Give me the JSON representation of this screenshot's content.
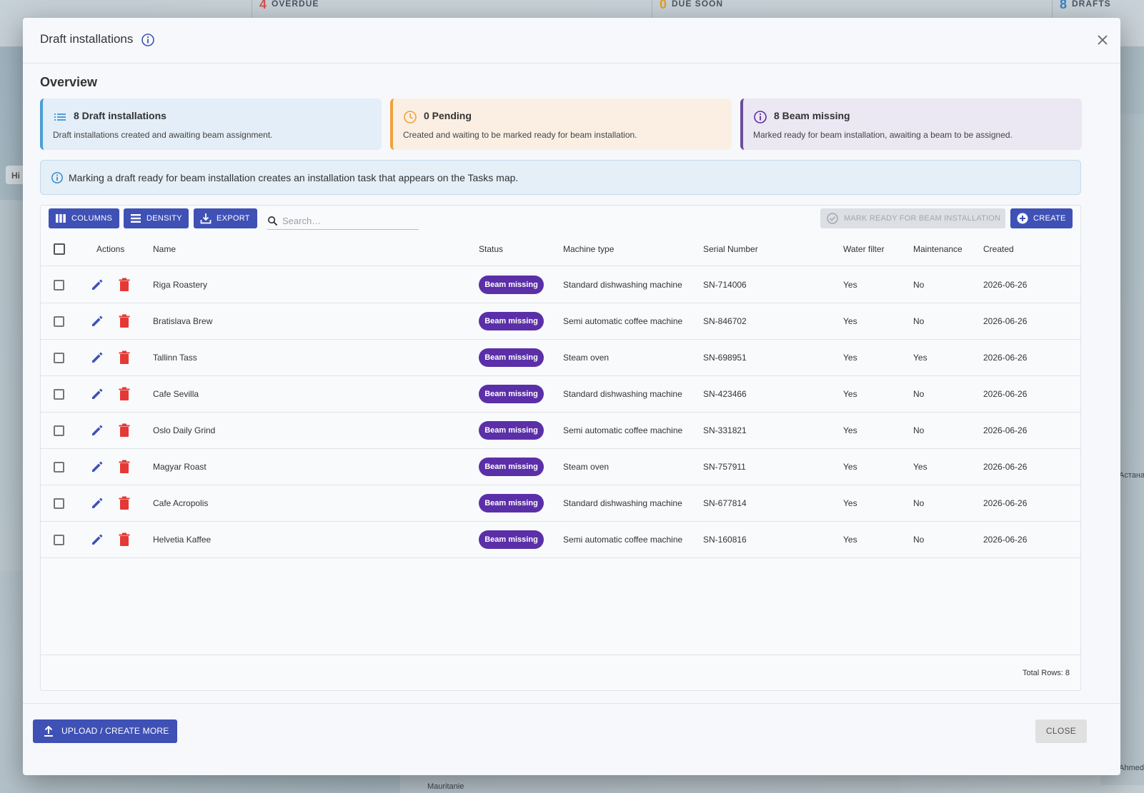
{
  "background": {
    "topbar": {
      "overdue": {
        "count": "4",
        "label": "OVERDUE"
      },
      "due_soon": {
        "count": "0",
        "label": "DUE SOON"
      },
      "drafts": {
        "count": "8",
        "label": "DRAFTS"
      }
    },
    "tab_label": "Hi",
    "map_labels": {
      "mauritanie": "Mauritanie",
      "astana": "Астана",
      "ahmed": "Ahmed"
    }
  },
  "dialog": {
    "title": "Draft installations",
    "overview_title": "Overview",
    "cards": [
      {
        "title": "8 Draft installations",
        "desc": "Draft installations created and awaiting beam assignment.",
        "icon": "list-icon",
        "color": "#4a9fd6"
      },
      {
        "title": "0 Pending",
        "desc": "Created and waiting to be marked ready for beam installation.",
        "icon": "clock-icon",
        "color": "#f0a13a"
      },
      {
        "title": "8 Beam missing",
        "desc": "Marked ready for beam installation, awaiting a beam to be assigned.",
        "icon": "info-icon",
        "color": "#6a4c9c"
      }
    ],
    "alert": "Marking a draft ready for beam installation creates an installation task that appears on the Tasks map.",
    "toolbar": {
      "columns": "COLUMNS",
      "density": "DENSITY",
      "export": "EXPORT",
      "search_placeholder": "Search…",
      "mark_ready": "MARK READY FOR BEAM INSTALLATION",
      "create": "CREATE"
    },
    "table": {
      "headers": {
        "actions": "Actions",
        "name": "Name",
        "status": "Status",
        "machine_type": "Machine type",
        "serial": "Serial Number",
        "water": "Water filter",
        "maintenance": "Maintenance",
        "created": "Created"
      },
      "rows": [
        {
          "name": "Riga Roastery",
          "status": "Beam missing",
          "machine_type": "Standard dishwashing machine",
          "serial": "SN-714006",
          "water": "Yes",
          "maintenance": "No",
          "created": "2026-06-26"
        },
        {
          "name": "Bratislava Brew",
          "status": "Beam missing",
          "machine_type": "Semi automatic coffee machine",
          "serial": "SN-846702",
          "water": "Yes",
          "maintenance": "No",
          "created": "2026-06-26"
        },
        {
          "name": "Tallinn Tass",
          "status": "Beam missing",
          "machine_type": "Steam oven",
          "serial": "SN-698951",
          "water": "Yes",
          "maintenance": "Yes",
          "created": "2026-06-26"
        },
        {
          "name": "Cafe Sevilla",
          "status": "Beam missing",
          "machine_type": "Standard dishwashing machine",
          "serial": "SN-423466",
          "water": "Yes",
          "maintenance": "No",
          "created": "2026-06-26"
        },
        {
          "name": "Oslo Daily Grind",
          "status": "Beam missing",
          "machine_type": "Semi automatic coffee machine",
          "serial": "SN-331821",
          "water": "Yes",
          "maintenance": "No",
          "created": "2026-06-26"
        },
        {
          "name": "Magyar Roast",
          "status": "Beam missing",
          "machine_type": "Steam oven",
          "serial": "SN-757911",
          "water": "Yes",
          "maintenance": "Yes",
          "created": "2026-06-26"
        },
        {
          "name": "Cafe Acropolis",
          "status": "Beam missing",
          "machine_type": "Standard dishwashing machine",
          "serial": "SN-677814",
          "water": "Yes",
          "maintenance": "No",
          "created": "2026-06-26"
        },
        {
          "name": "Helvetia Kaffee",
          "status": "Beam missing",
          "machine_type": "Semi automatic coffee machine",
          "serial": "SN-160816",
          "water": "Yes",
          "maintenance": "No",
          "created": "2026-06-26"
        }
      ],
      "total": "Total Rows: 8"
    },
    "footer": {
      "upload": "UPLOAD / CREATE MORE",
      "close": "CLOSE"
    },
    "colors": {
      "primary": "#3f51b5",
      "badge": "#5b2fa8",
      "delete": "#e53935"
    }
  }
}
